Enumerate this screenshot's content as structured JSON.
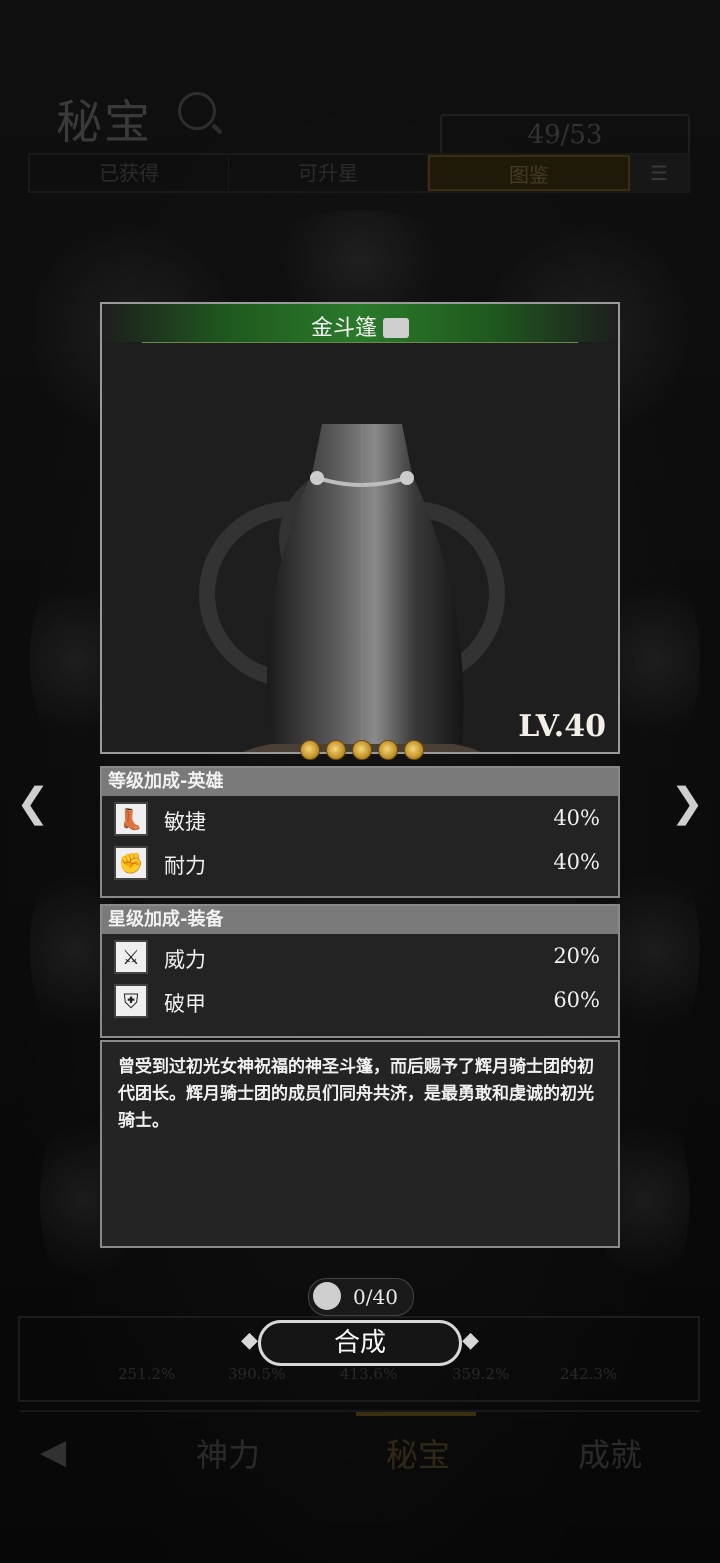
{
  "header": {
    "title": "秘宝",
    "count": "49/53"
  },
  "tabs": [
    {
      "label": "已获得",
      "active": false
    },
    {
      "label": "可升星",
      "active": false
    },
    {
      "label": "图鉴",
      "active": true
    }
  ],
  "item": {
    "name": "金斗篷",
    "level": "LV.40",
    "stars": 5
  },
  "level_bonus": {
    "title": "等级加成-英雄",
    "stats": [
      {
        "icon": "boot-icon",
        "label": "敏捷",
        "value": "40%"
      },
      {
        "icon": "fist-icon",
        "label": "耐力",
        "value": "40%"
      }
    ]
  },
  "star_bonus": {
    "title": "星级加成-装备",
    "stats": [
      {
        "icon": "swords-icon",
        "label": "威力",
        "value": "20%"
      },
      {
        "icon": "shield-break-icon",
        "label": "破甲",
        "value": "60%"
      }
    ]
  },
  "description": "曾受到过初光女神祝福的神圣斗篷，而后赐予了辉月骑士团的初代团长。辉月骑士团的成员们同舟共济，是最勇敢和虔诚的初光骑士。",
  "pieces": "0/40",
  "craft_label": "合成",
  "bonuses": [
    "251.2%",
    "390.5%",
    "413.6%",
    "359.2%",
    "242.3%"
  ],
  "nav": {
    "items": [
      "神力",
      "秘宝",
      "成就"
    ],
    "active": "秘宝"
  },
  "colors": {
    "header_green": "#2b7a2b",
    "star_gold": "#f7d77a",
    "panel_title": "#7a7a7a"
  }
}
